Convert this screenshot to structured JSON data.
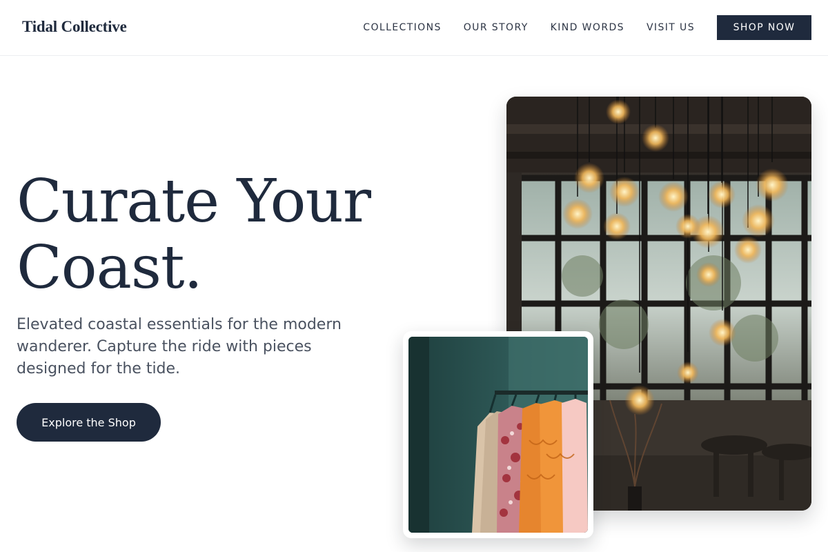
{
  "nav": {
    "brand": "Tidal Collective",
    "links": [
      {
        "label": "COLLECTIONS"
      },
      {
        "label": "OUR STORY"
      },
      {
        "label": "KIND WORDS"
      },
      {
        "label": "VISIT US"
      }
    ],
    "cta": "SHOP NOW"
  },
  "hero": {
    "title_line1": "Curate Your",
    "title_line2": "Coast.",
    "subtitle": "Elevated coastal essentials for the modern wanderer. Capture the ride with pieces designed for the tide.",
    "button": "Explore the Shop"
  },
  "colors": {
    "primary": "#1f2a3d",
    "text_muted": "#4a5260",
    "background": "#ffffff"
  }
}
